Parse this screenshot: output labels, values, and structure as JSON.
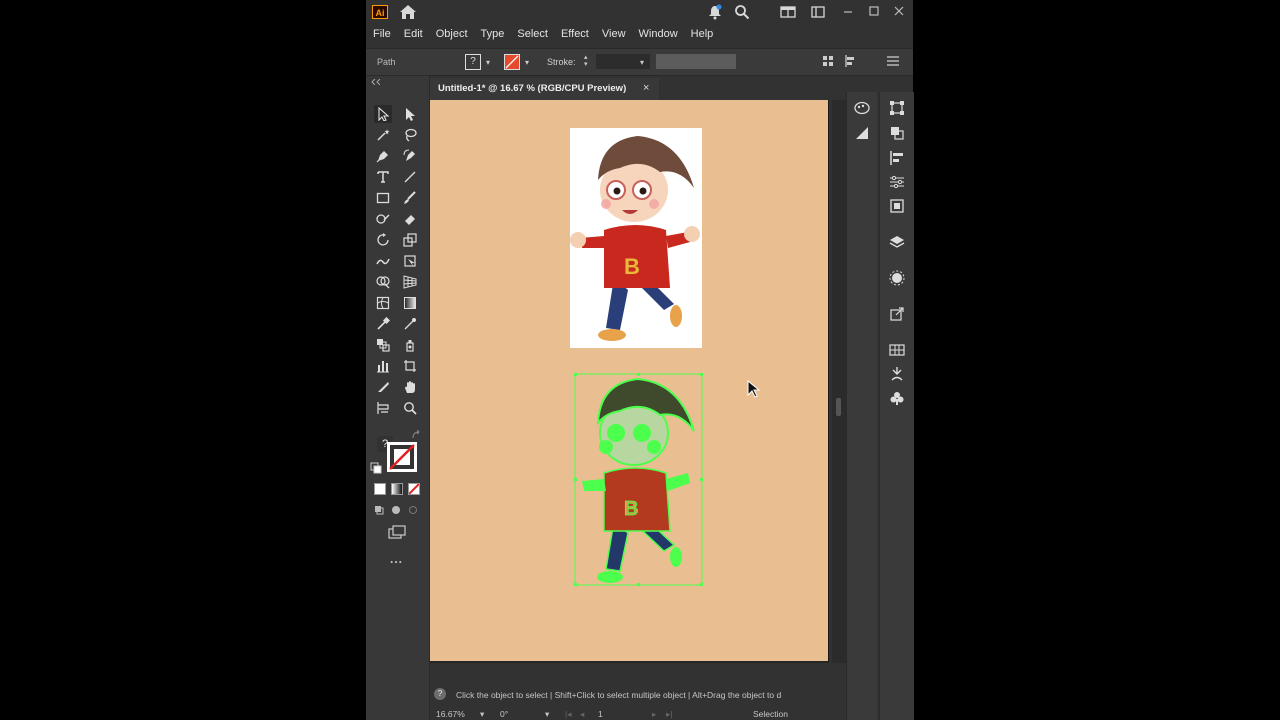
{
  "app": {
    "logo_text": "Ai",
    "accent": "#ff9a00"
  },
  "menu": [
    "File",
    "Edit",
    "Object",
    "Type",
    "Select",
    "Effect",
    "View",
    "Window",
    "Help"
  ],
  "control_bar": {
    "selection_type": "Path",
    "fill_label": "?",
    "stroke_label": "Stroke:",
    "stroke_color": "#e64a2e"
  },
  "document": {
    "tab_title": "Untitled-1* @ 16.67 % (RGB/CPU Preview)",
    "close_glyph": "×",
    "artboard_color": "#e9bf92",
    "selection_color": "#4cff4c"
  },
  "toolbar": {
    "fill_stroke_unknown": "?",
    "more_tools": "..."
  },
  "status": {
    "hint": "Click the object to select  |  Shift+Click to select multiple object  |  Alt+Drag the object to d",
    "zoom": "16.67%",
    "rotation": "0°",
    "artboard_number": "1",
    "current_tool": "Selection"
  }
}
